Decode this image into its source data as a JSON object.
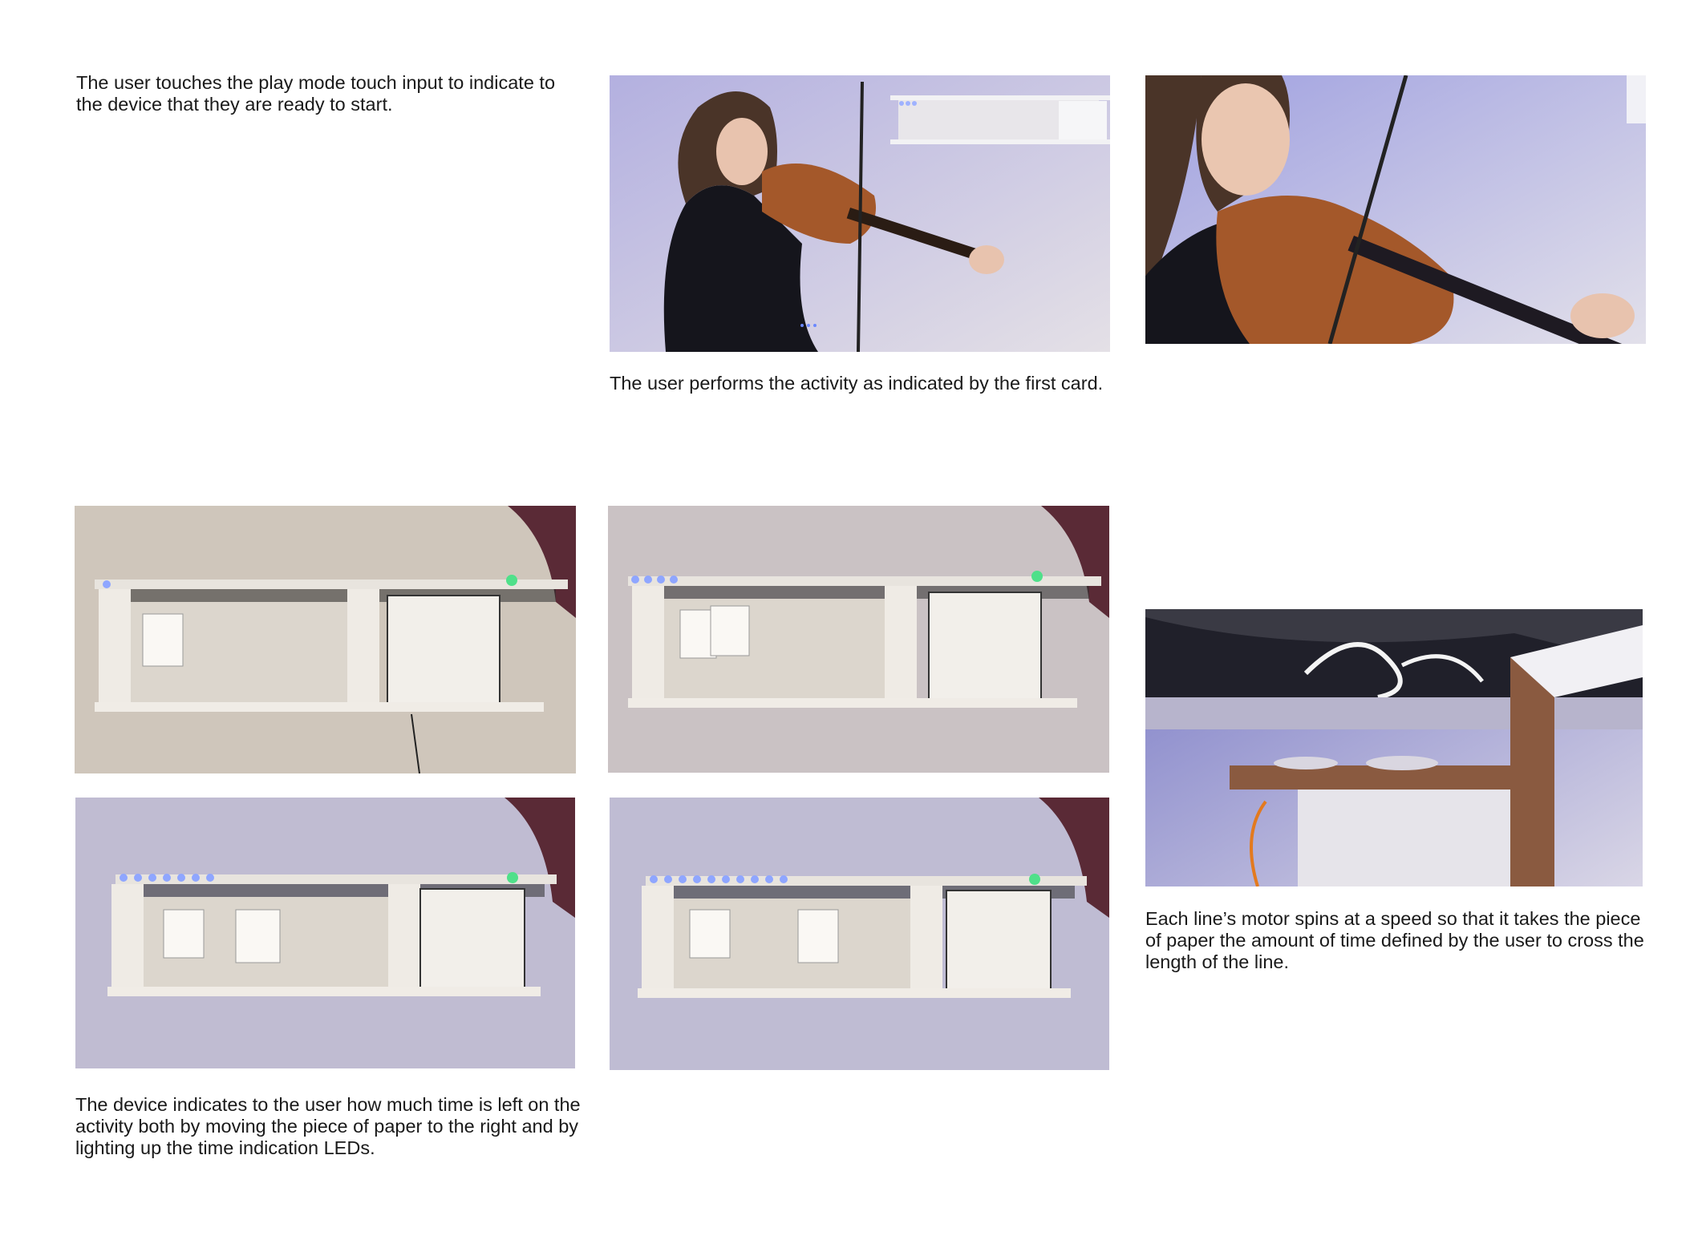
{
  "captions": {
    "play_mode": "The user touches the play mode touch input to indicate to the device that they are ready to start.",
    "performs_activity": "The user performs the activity as indicated by the first card.",
    "time_left": "The device indicates to the user how much time is left on the activity both by moving the piece of paper to the right and by lighting up the time indication LEDs.",
    "motor_speed": "Each line’s motor spins at a speed so that it takes the piece of paper the amount of time defined by the user to cross the length of the line."
  },
  "photos": {
    "violinist_wide": "photo of user playing violin beside the shelf device",
    "violinist_close": "close-up photo of user playing violin",
    "shelf_leds_1": "shelf device with one time LED lit",
    "shelf_leds_4": "shelf device with four time LEDs lit",
    "shelf_leds_7": "shelf device with seven time LEDs lit",
    "shelf_leds_10": "shelf device with ten time LEDs lit",
    "motor_underside": "close-up of motor and wiring under the shelf"
  },
  "led_counts": {
    "shelf_1": 1,
    "shelf_2": 4,
    "shelf_3": 7,
    "shelf_4": 10
  },
  "colors": {
    "wall": "#cfc6bb",
    "shelf": "#e8e4de",
    "led_blue": "#8fa6ff",
    "led_green": "#4fe08a",
    "violin": "#a4582a",
    "shirt": "#15151c"
  }
}
